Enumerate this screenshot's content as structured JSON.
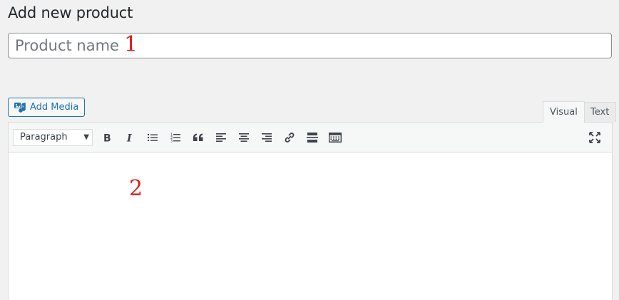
{
  "page": {
    "title": "Add new product"
  },
  "title_field": {
    "placeholder": "Product name",
    "value": ""
  },
  "annotations": {
    "one": "1",
    "two": "2"
  },
  "media": {
    "add_media_label": "Add Media",
    "icon": "add-media-icon"
  },
  "editor_tabs": {
    "visual": "Visual",
    "text": "Text",
    "active": "Visual"
  },
  "toolbar": {
    "format_value": "Paragraph",
    "buttons": [
      "bold-icon",
      "italic-icon",
      "bulleted-list-icon",
      "numbered-list-icon",
      "blockquote-icon",
      "align-left-icon",
      "align-center-icon",
      "align-right-icon",
      "link-icon",
      "read-more-icon",
      "toolbar-toggle-icon"
    ],
    "fullscreen": "fullscreen-icon"
  },
  "colors": {
    "accent": "#2271b1",
    "annotation": "#e21b1b",
    "background": "#f1f1f1"
  }
}
